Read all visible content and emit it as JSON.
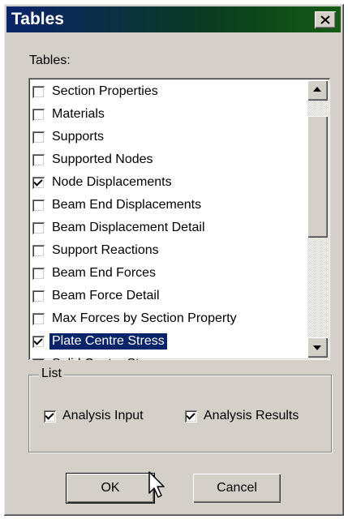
{
  "window": {
    "title": "Tables",
    "close_label": "✕"
  },
  "tables_label": "Tables:",
  "table_items": [
    {
      "label": "Section Properties",
      "checked": false,
      "selected": false
    },
    {
      "label": "Materials",
      "checked": false,
      "selected": false
    },
    {
      "label": "Supports",
      "checked": false,
      "selected": false
    },
    {
      "label": "Supported Nodes",
      "checked": false,
      "selected": false
    },
    {
      "label": "Node Displacements",
      "checked": true,
      "selected": false
    },
    {
      "label": "Beam End Displacements",
      "checked": false,
      "selected": false
    },
    {
      "label": "Beam Displacement Detail",
      "checked": false,
      "selected": false
    },
    {
      "label": "Support Reactions",
      "checked": false,
      "selected": false
    },
    {
      "label": "Beam End Forces",
      "checked": false,
      "selected": false
    },
    {
      "label": "Beam Force Detail",
      "checked": false,
      "selected": false
    },
    {
      "label": "Max Forces by Section Property",
      "checked": false,
      "selected": false
    },
    {
      "label": "Plate Centre Stress",
      "checked": true,
      "selected": true
    },
    {
      "label": "Solid Centre Stress",
      "checked": false,
      "selected": false
    }
  ],
  "list_group": {
    "title": "List",
    "analysis_input": {
      "label": "Analysis Input",
      "checked": true
    },
    "analysis_results": {
      "label": "Analysis Results",
      "checked": true
    }
  },
  "buttons": {
    "ok": "OK",
    "cancel": "Cancel"
  }
}
